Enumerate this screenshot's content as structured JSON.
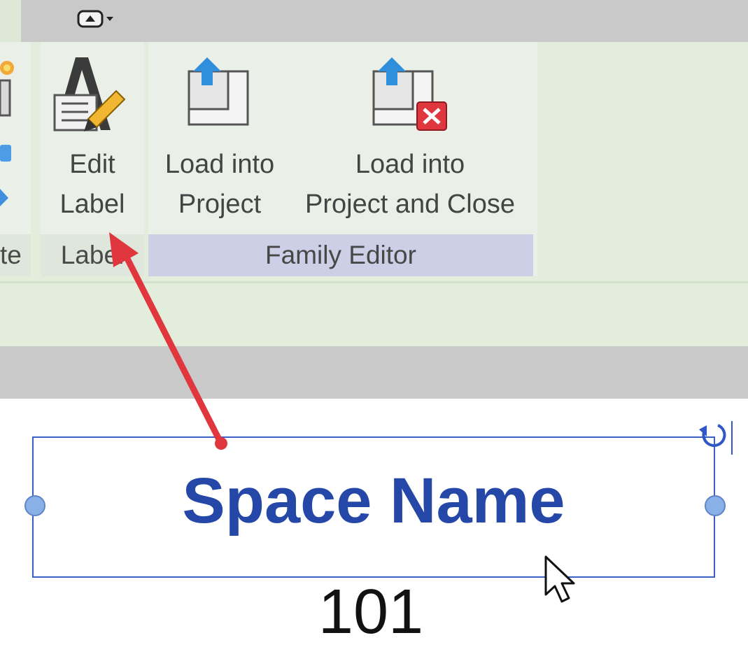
{
  "ribbon": {
    "prev_panel_title_partial": "te",
    "label_panel": {
      "title": "Label",
      "edit_label_line1": "Edit",
      "edit_label_line2": "Label"
    },
    "family_editor_panel": {
      "title": "Family Editor",
      "load_into_project_line1": "Load into",
      "load_into_project_line2": "Project",
      "load_close_line1": "Load into",
      "load_close_line2": "Project and Close"
    }
  },
  "canvas": {
    "label_text": "Space Name",
    "number_text": "101"
  },
  "colors": {
    "ribbon_bg": "#e2eedb",
    "panel_title_bg": "#dfe6db",
    "family_editor_title_bg": "#cdcfe6",
    "label_text": "#2547a8",
    "selection_box": "#3b5fc4",
    "annotation_arrow": "#e0373f"
  },
  "icons": {
    "qat_button": "ribbon-toggle-icon",
    "edit_label": "edit-label-icon",
    "load_into_project": "load-into-project-icon",
    "load_and_close": "load-and-close-icon",
    "rotate": "rotate-icon",
    "cursor": "mouse-pointer-icon"
  }
}
